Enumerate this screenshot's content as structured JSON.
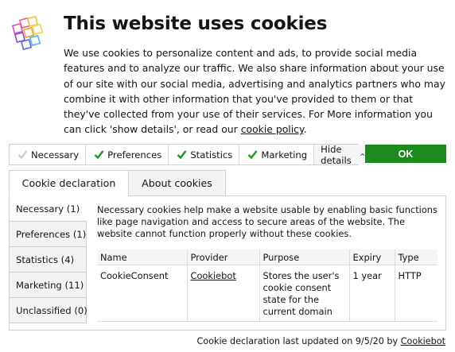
{
  "title": "This website uses cookies",
  "intro": {
    "text": "We use cookies to personalize content and ads, to provide social media features and to analyze our traffic. We also share information about your use of our site with our social media, advertising and analytics partners who may combine it with other information that you've provided to them or that they've collected from your use of their services. For More information you can click 'show details', or read our ",
    "link": "cookie policy",
    "suffix": "."
  },
  "checkboxes": [
    {
      "label": "Necessary",
      "checked": true,
      "disabled": true
    },
    {
      "label": "Preferences",
      "checked": true,
      "disabled": false
    },
    {
      "label": "Statistics",
      "checked": true,
      "disabled": false
    },
    {
      "label": "Marketing",
      "checked": true,
      "disabled": false
    }
  ],
  "details_button": "Hide details",
  "ok_button": "OK",
  "tabs": [
    "Cookie declaration",
    "About cookies"
  ],
  "sidebar": [
    "Necessary (1)",
    "Preferences (1)",
    "Statistics (4)",
    "Marketing (11)",
    "Unclassified (0)"
  ],
  "necessary_desc": "Necessary cookies help make a website usable by enabling basic functions like page navigation and access to secure areas of the website. The website cannot function properly without these cookies.",
  "table": {
    "headers": [
      "Name",
      "Provider",
      "Purpose",
      "Expiry",
      "Type"
    ],
    "rows": [
      [
        "CookieConsent",
        "Cookiebot",
        "Stores the user's cookie consent state for the current domain",
        "1 year",
        "HTTP"
      ]
    ]
  },
  "footer": {
    "text": "Cookie declaration last updated on 9/5/20 by ",
    "link": "Cookiebot"
  },
  "colors": {
    "accent_green": "#1c8a1e",
    "check_green": "#1a9c1c"
  }
}
